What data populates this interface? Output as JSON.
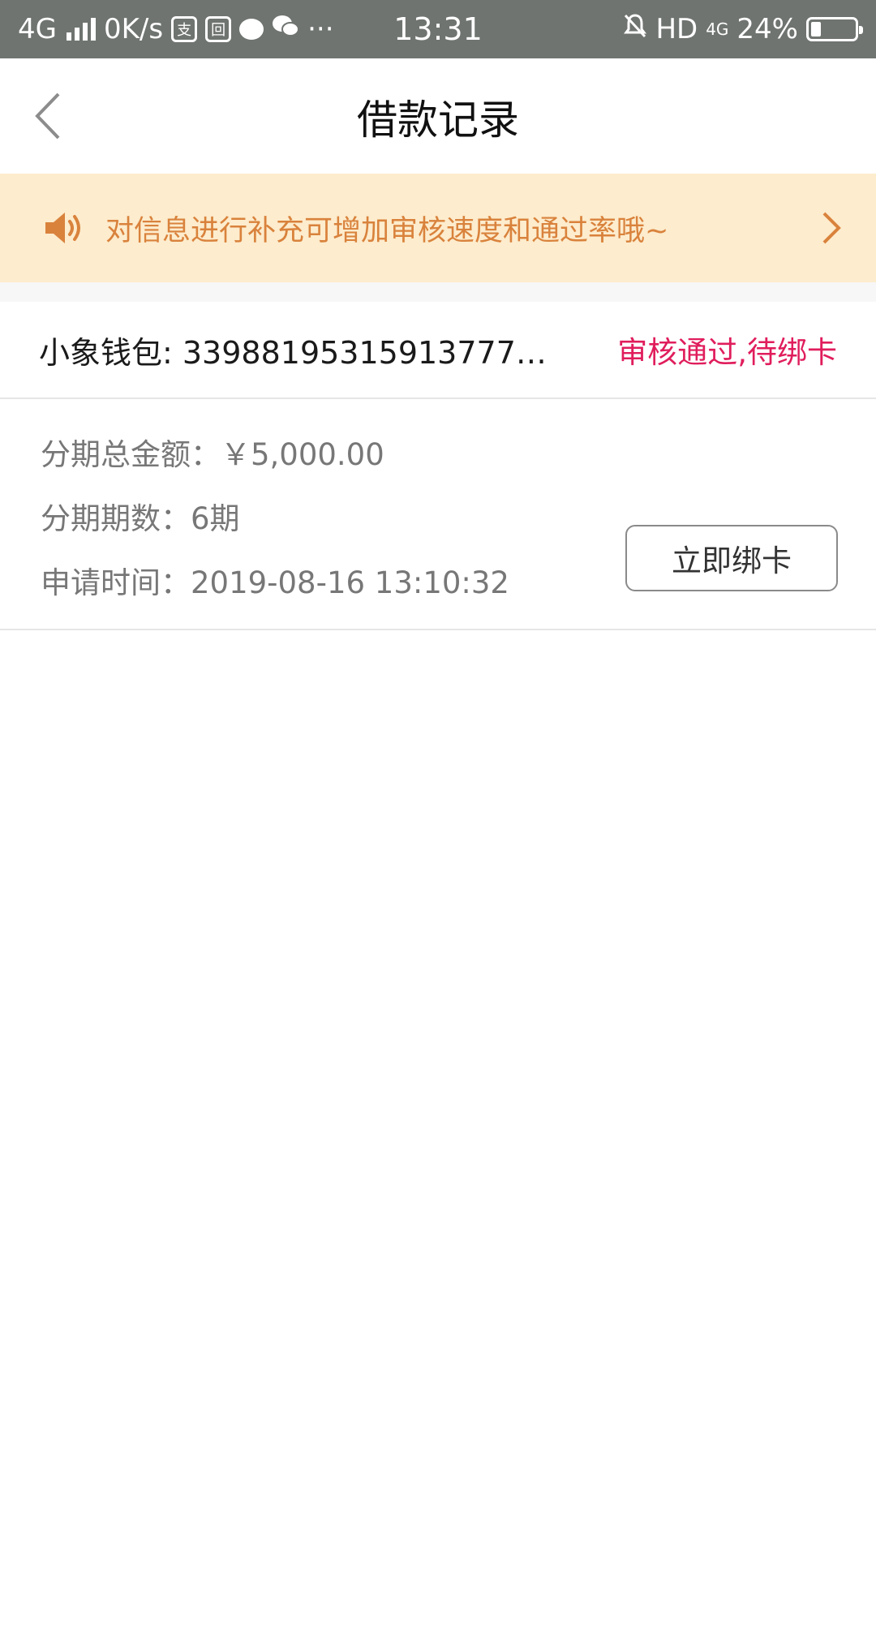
{
  "status_bar": {
    "network": "4G",
    "speed": "0K/s",
    "app_icon_1": "支",
    "app_icon_2": "回",
    "dots": "···",
    "time": "13:31",
    "hd": "HD",
    "net_right": "4G",
    "battery_text": "24%",
    "battery_level": 0.24
  },
  "header": {
    "title": "借款记录"
  },
  "notice": {
    "text": "对信息进行补充可增加审核速度和通过率哦~"
  },
  "record": {
    "wallet": "小象钱包: 33988195315913777…",
    "status": "审核通过,待绑卡",
    "total_amount": "分期总金额：￥5,000.00",
    "periods": "分期期数：6期",
    "apply_time": "申请时间：2019-08-16 13:10:32",
    "bind_button": "立即绑卡"
  },
  "colors": {
    "status_bar_bg": "#6f7470",
    "notice_bg": "#fdeccd",
    "notice_text": "#d9823c",
    "status_accent": "#e01d5c"
  },
  "icons": {
    "back": "chevron-left-icon",
    "notice_speaker": "speaker-icon",
    "notice_arrow": "chevron-right-icon"
  }
}
